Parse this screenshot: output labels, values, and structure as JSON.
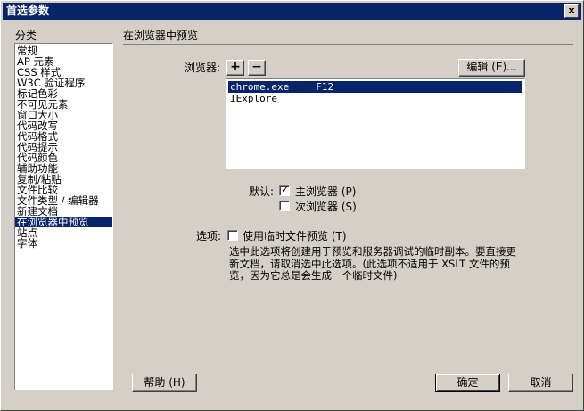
{
  "window": {
    "title": "首选参数",
    "close_label": "x"
  },
  "sidebar": {
    "heading": "分类",
    "items": [
      {
        "label": "常规",
        "selected": false
      },
      {
        "label": "AP 元素",
        "selected": false
      },
      {
        "label": "CSS 样式",
        "selected": false
      },
      {
        "label": "W3C 验证程序",
        "selected": false
      },
      {
        "label": "标记色彩",
        "selected": false
      },
      {
        "label": "不可见元素",
        "selected": false
      },
      {
        "label": "窗口大小",
        "selected": false
      },
      {
        "label": "代码改写",
        "selected": false
      },
      {
        "label": "代码格式",
        "selected": false
      },
      {
        "label": "代码提示",
        "selected": false
      },
      {
        "label": "代码颜色",
        "selected": false
      },
      {
        "label": "辅助功能",
        "selected": false
      },
      {
        "label": "复制/粘贴",
        "selected": false
      },
      {
        "label": "文件比较",
        "selected": false
      },
      {
        "label": "文件类型 / 编辑器",
        "selected": false
      },
      {
        "label": "新建文档",
        "selected": false
      },
      {
        "label": "在浏览器中预览",
        "selected": true
      },
      {
        "label": "站点",
        "selected": false
      },
      {
        "label": "字体",
        "selected": false
      }
    ]
  },
  "main": {
    "section_title": "在浏览器中预览",
    "browsers_label": "浏览器:",
    "add_label": "+",
    "remove_label": "−",
    "edit_label": "编辑 (E)...",
    "browsers": [
      {
        "name": "chrome.exe",
        "key": "F12",
        "selected": true
      },
      {
        "name": "IExplore",
        "key": "",
        "selected": false
      }
    ],
    "default_label": "默认:",
    "primary_label": "主浏览器 (P)",
    "primary_checked": true,
    "secondary_label": "次浏览器 (S)",
    "secondary_checked": false,
    "options_label": "选项:",
    "temp_label": "使用临时文件预览 (T)",
    "temp_checked": false,
    "description_lines": [
      "选中此选项将创建用于预览和服务器调试的临时副本。要直接更",
      "新文档，请取消选中此选项。(此选项不适用于 XSLT 文件的预",
      "览，因为它总是会生成一个临时文件)"
    ]
  },
  "footer": {
    "help_label": "帮助 (H)",
    "ok_label": "确定",
    "cancel_label": "取消"
  }
}
